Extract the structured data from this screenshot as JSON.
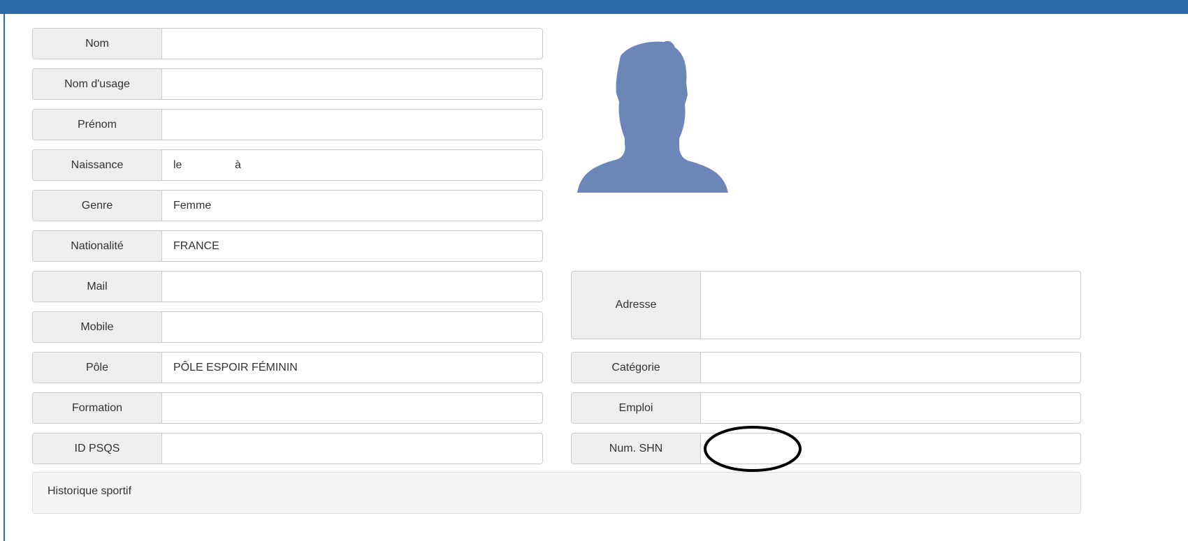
{
  "fields_left": [
    {
      "label": "Nom",
      "value": ""
    },
    {
      "label": "Nom d'usage",
      "value": ""
    },
    {
      "label": "Prénom",
      "value": ""
    },
    {
      "label": "Naissance",
      "value": "le                 à"
    },
    {
      "label": "Genre",
      "value": "Femme"
    },
    {
      "label": "Nationalité",
      "value": "FRANCE"
    },
    {
      "label": "Mail",
      "value": ""
    },
    {
      "label": "Mobile",
      "value": ""
    },
    {
      "label": "Pôle",
      "value": "PÔLE ESPOIR FÉMININ"
    },
    {
      "label": "Formation",
      "value": ""
    },
    {
      "label": "ID PSQS",
      "value": ""
    }
  ],
  "fields_right": [
    {
      "label": "Adresse",
      "value": ""
    },
    {
      "label": "Catégorie",
      "value": ""
    },
    {
      "label": "Emploi",
      "value": ""
    },
    {
      "label": "Num. SHN",
      "value": ""
    }
  ],
  "history": {
    "title": "Historique sportif"
  },
  "colors": {
    "accent": "#2f6aa9",
    "avatar": "#6d86b8",
    "label_bg": "#eeeeee"
  },
  "icons": {
    "avatar": "user-silhouette-icon"
  }
}
